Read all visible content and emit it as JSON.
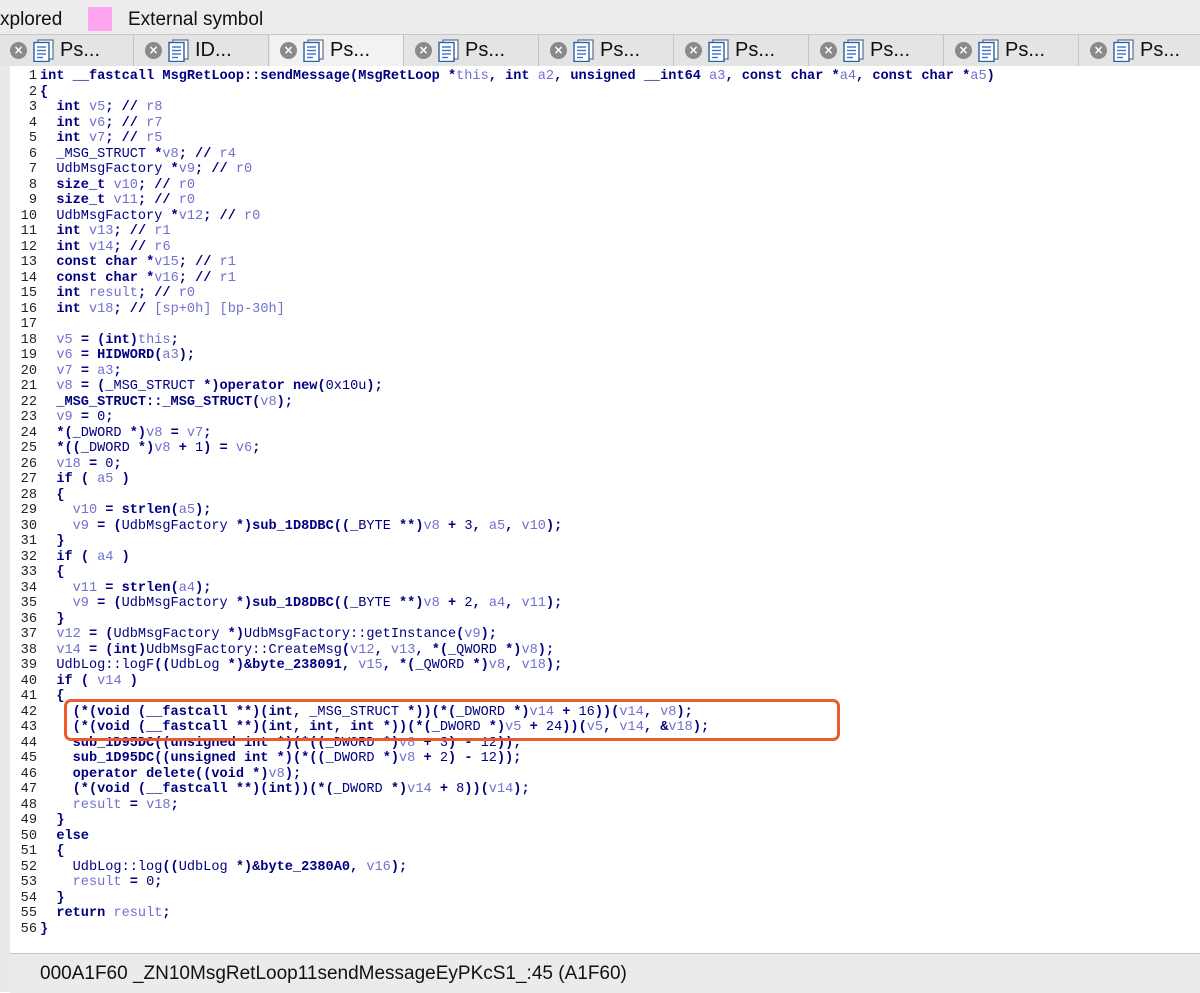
{
  "legend": {
    "explored_label": "xplored",
    "external_symbol_label": "External symbol",
    "external_symbol_color": "#ffa6f0"
  },
  "tabs": [
    {
      "label": "Ps...",
      "icon": "pseudocode-doc-icon",
      "active": false
    },
    {
      "label": "ID...",
      "icon": "pseudocode-doc-icon",
      "active": false
    },
    {
      "label": "Ps...",
      "icon": "pseudocode-doc-icon",
      "active": true
    },
    {
      "label": "Ps...",
      "icon": "pseudocode-doc-icon",
      "active": false
    },
    {
      "label": "Ps...",
      "icon": "pseudocode-doc-icon",
      "active": false
    },
    {
      "label": "Ps...",
      "icon": "pseudocode-doc-icon",
      "active": false
    },
    {
      "label": "Ps...",
      "icon": "pseudocode-doc-icon",
      "active": false
    },
    {
      "label": "Ps...",
      "icon": "pseudocode-doc-icon",
      "active": false
    },
    {
      "label": "Ps...",
      "icon": "pseudocode-doc-icon",
      "active": false
    }
  ],
  "code_lines": [
    "int __fastcall MsgRetLoop::sendMessage(MsgRetLoop *this, int a2, unsigned __int64 a3, const char *a4, const char *a5)",
    "{",
    "  int v5; // r8",
    "  int v6; // r7",
    "  int v7; // r5",
    "  _MSG_STRUCT *v8; // r4",
    "  UdbMsgFactory *v9; // r0",
    "  size_t v10; // r0",
    "  size_t v11; // r0",
    "  UdbMsgFactory *v12; // r0",
    "  int v13; // r1",
    "  int v14; // r6",
    "  const char *v15; // r1",
    "  const char *v16; // r1",
    "  int result; // r0",
    "  int v18; // [sp+0h] [bp-30h]",
    "",
    "  v5 = (int)this;",
    "  v6 = HIDWORD(a3);",
    "  v7 = a3;",
    "  v8 = (_MSG_STRUCT *)operator new(0x10u);",
    "  _MSG_STRUCT::_MSG_STRUCT(v8);",
    "  v9 = 0;",
    "  *(_DWORD *)v8 = v7;",
    "  *((_DWORD *)v8 + 1) = v6;",
    "  v18 = 0;",
    "  if ( a5 )",
    "  {",
    "    v10 = strlen(a5);",
    "    v9 = (UdbMsgFactory *)sub_1D8DBC((_BYTE **)v8 + 3, a5, v10);",
    "  }",
    "  if ( a4 )",
    "  {",
    "    v11 = strlen(a4);",
    "    v9 = (UdbMsgFactory *)sub_1D8DBC((_BYTE **)v8 + 2, a4, v11);",
    "  }",
    "  v12 = (UdbMsgFactory *)UdbMsgFactory::getInstance(v9);",
    "  v14 = (int)UdbMsgFactory::CreateMsg(v12, v13, *(_QWORD *)v8);",
    "  UdbLog::logF((UdbLog *)&byte_238091, v15, *(_QWORD *)v8, v18);",
    "  if ( v14 )",
    "  {",
    "    (*(void (__fastcall **)(int, _MSG_STRUCT *))(*(_DWORD *)v14 + 16))(v14, v8);",
    "    (*(void (__fastcall **)(int, int, int *))(*(_DWORD *)v5 + 24))(v5, v14, &v18);",
    "    sub_1D95DC((unsigned int *)(*((_DWORD *)v8 + 3) - 12));",
    "    sub_1D95DC((unsigned int *)(*((_DWORD *)v8 + 2) - 12));",
    "    operator delete((void *)v8);",
    "    (*(void (__fastcall **)(int))(*(_DWORD *)v14 + 8))(v14);",
    "    result = v18;",
    "  }",
    "  else",
    "  {",
    "    UdbLog::log((UdbLog *)&byte_2380A0, v16);",
    "    result = 0;",
    "  }",
    "  return result;",
    "}"
  ],
  "highlight": {
    "lines": [
      42,
      43
    ],
    "color": "#ec5a2e"
  },
  "status": {
    "text": "000A1F60  _ZN10MsgRetLoop11sendMessageEyPKcS1_:45 (A1F60)"
  }
}
